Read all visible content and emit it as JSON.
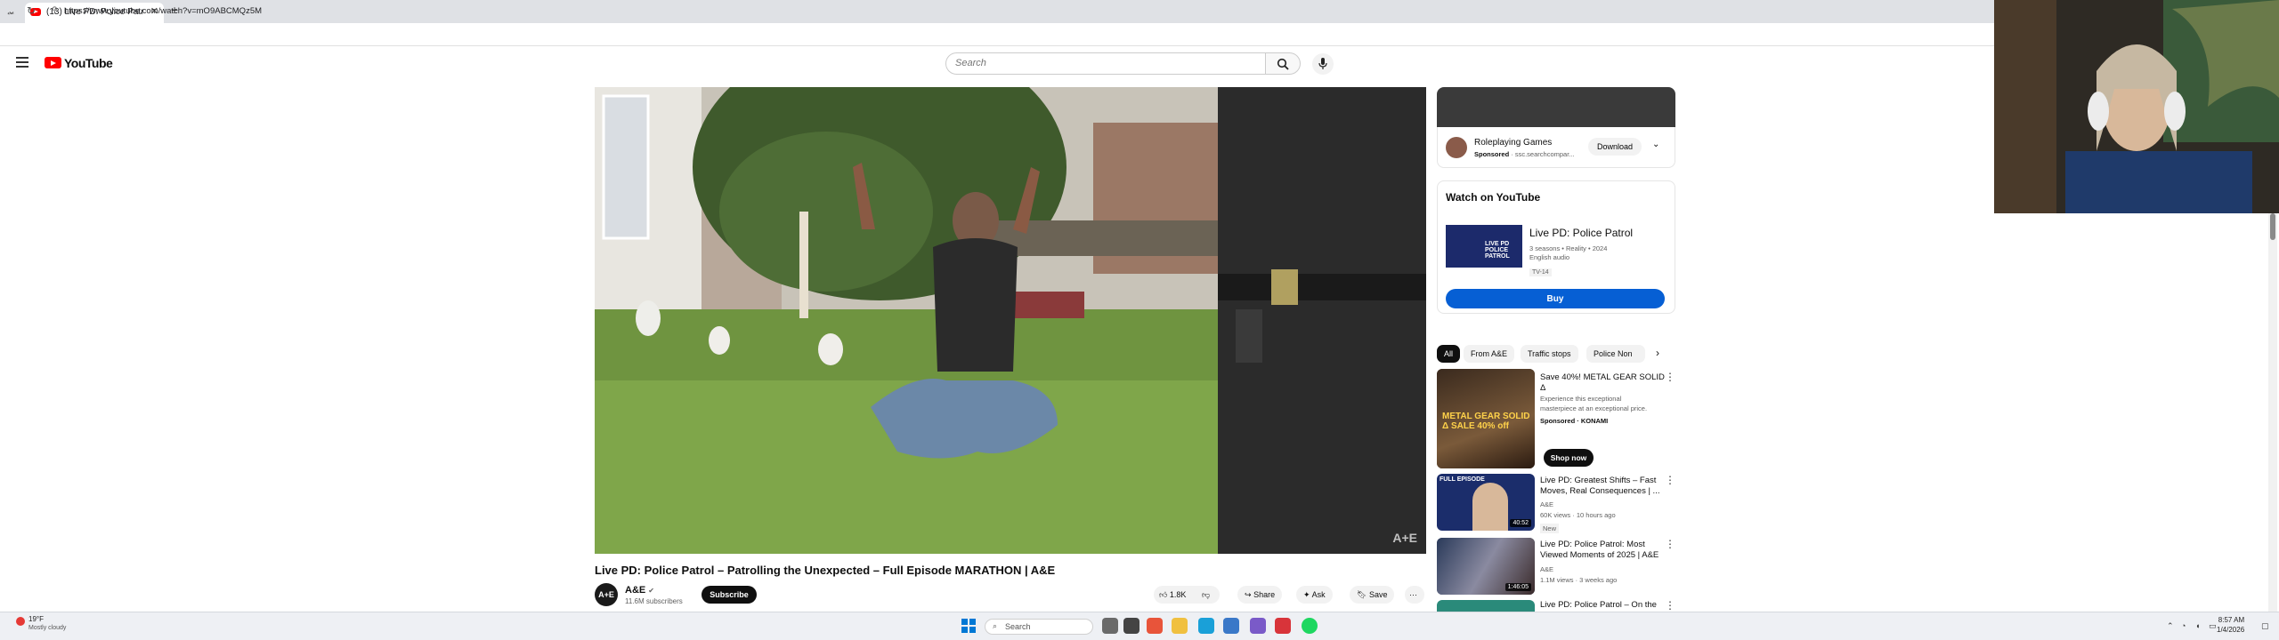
{
  "browser": {
    "tab_title": "(13) Live PD: Police Patrol – Pa...",
    "tab_close": "✕",
    "new_tab": "+",
    "url": "https://www.youtube.com/watch?v=mO9ABCMQz5M"
  },
  "youtube": {
    "logo_text": "YouTube",
    "search_placeholder": "Search"
  },
  "video": {
    "title": "Live PD: Police Patrol – Patrolling the Unexpected – Full Episode MARATHON | A&E",
    "watermark": "A+E",
    "channel": {
      "name": "A&E",
      "avatar_text": "A+E",
      "subscribers": "11.6M subscribers",
      "subscribe_label": "Subscribe"
    },
    "actions": {
      "likes": "1.8K",
      "share": "Share",
      "ask": "Ask",
      "save": "Save"
    }
  },
  "sidebar": {
    "ad": {
      "title": "Roleplaying Games",
      "sponsored": "Sponsored",
      "domain": "· ssc.searchcompar...",
      "download_label": "Download"
    },
    "watch_on_youtube": {
      "heading": "Watch on YouTube",
      "show_title": "Live PD: Police Patrol",
      "thumb_text": "LIVE PD POLICE PATROL",
      "meta_line1": "3 seasons • Reality • 2024",
      "meta_line2": "English audio",
      "rating": "TV-14",
      "buy_label": "Buy"
    },
    "chips": [
      "All",
      "From A&E",
      "Traffic stops",
      "Police Non"
    ],
    "recommendations": [
      {
        "title": "Save 40%! METAL GEAR SOLID Δ",
        "line1": "Experience this exceptional masterpiece at an exceptional price.",
        "line2": "Sponsored · KONAMI",
        "thumb_text": "METAL GEAR SOLID Δ SALE 40% off",
        "action": "Shop now"
      },
      {
        "title": "Live PD: Greatest Shifts – Fast Moves, Real Consequences | ...",
        "line1": "A&E",
        "line2": "60K views · 10 hours ago",
        "badge": "New",
        "duration": "40:52",
        "thumb_text": "FULL EPISODE"
      },
      {
        "title": "Live PD: Police Patrol: Most Viewed Moments of 2025 | A&E",
        "line1": "A&E",
        "line2": "1.1M views · 3 weeks ago",
        "duration": "1:46:05"
      },
      {
        "title": "Live PD: Police Patrol – On the"
      }
    ]
  },
  "taskbar": {
    "temp": "19°F",
    "weather": "Mostly cloudy",
    "search": "Search",
    "time": "8:57 AM",
    "date": "1/4/2026"
  },
  "colors": {
    "youtube_red": "#ff0000",
    "buy_blue": "#065fd4",
    "text": "#0f0f0f"
  }
}
